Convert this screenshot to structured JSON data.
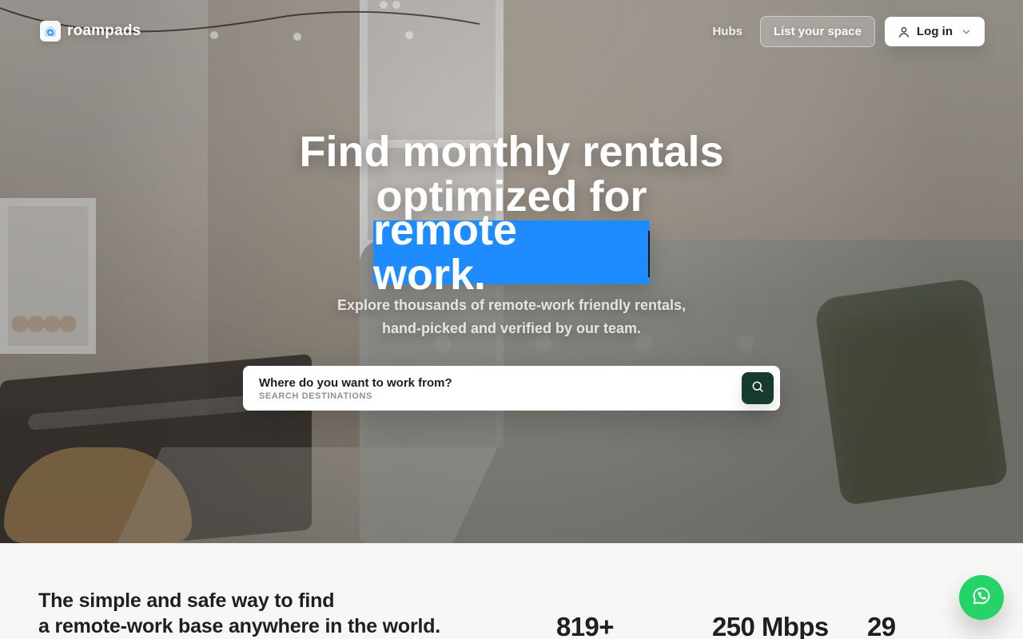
{
  "header": {
    "logo_text": "roampads",
    "nav": {
      "hubs": "Hubs",
      "list_space": "List your space",
      "login": "Log in"
    }
  },
  "hero": {
    "headline_line1": "Find monthly rentals",
    "headline_line2": "optimized for",
    "headline_highlight": "remote work.",
    "subtitle_line1": "Explore thousands of remote-work friendly rentals,",
    "subtitle_line2": "hand-picked and verified by our team."
  },
  "search": {
    "title": "Where do you want to work from?",
    "subtitle": "SEARCH DESTINATIONS"
  },
  "bottom": {
    "heading_line1": "The simple and safe way to find",
    "heading_line2": "a remote-work base anywhere in the world.",
    "stats": [
      {
        "value": "819+"
      },
      {
        "value": "250 Mbps"
      },
      {
        "value": "29"
      }
    ]
  },
  "colors": {
    "highlight_blue": "#1e8cff",
    "search_button": "#173a2f",
    "whatsapp_green": "#25d366"
  },
  "icons": {
    "logo": "roampads-logo-icon",
    "user": "user-icon",
    "chevron": "chevron-down-icon",
    "search": "search-icon",
    "whatsapp": "whatsapp-icon"
  }
}
